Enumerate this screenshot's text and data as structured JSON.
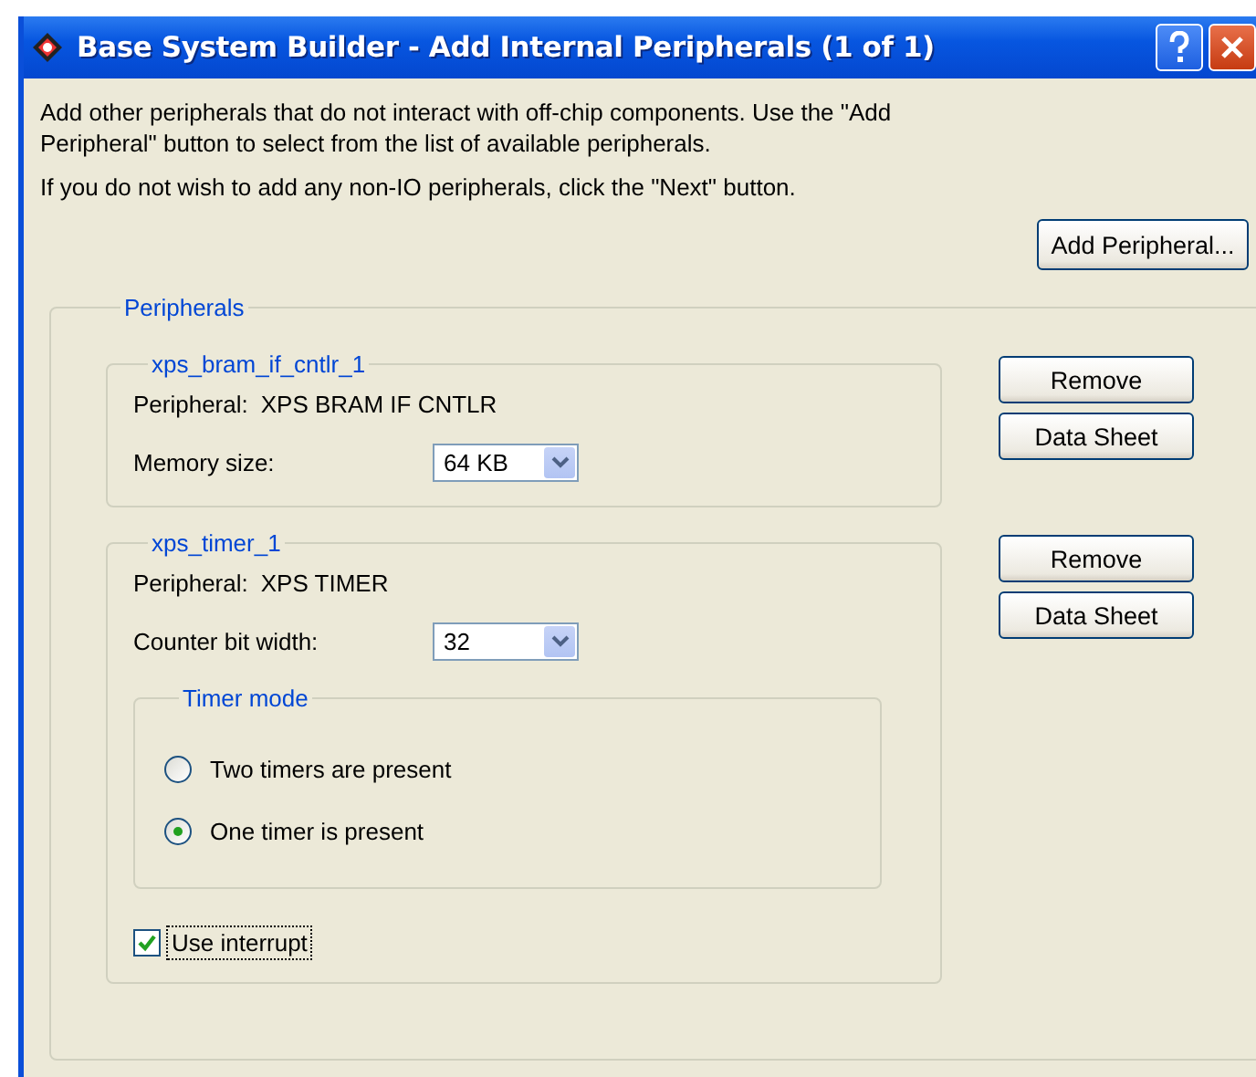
{
  "window": {
    "title": "Base System Builder - Add Internal Peripherals (1 of 1)"
  },
  "intro": [
    "Add other peripherals that do not interact with off-chip components.  Use the \"Add Peripheral\" button to select from the list of available peripherals.",
    "If you do not wish to add any non-IO peripherals, click the \"Next\" button."
  ],
  "add_button": "Add Peripheral...",
  "peripherals_group": {
    "title": "Peripherals",
    "items": [
      {
        "name": "xps_bram_if_cntlr_1",
        "peripheral_label": "Peripheral:",
        "peripheral_value": "XPS BRAM IF CNTLR",
        "buttons": [
          "Remove",
          "Data Sheet"
        ],
        "fields": [
          {
            "kind": "dropdown",
            "label": "Memory size:",
            "value": "64 KB"
          }
        ]
      },
      {
        "name": "xps_timer_1",
        "peripheral_label": "Peripheral:",
        "peripheral_value": "XPS TIMER",
        "buttons": [
          "Remove",
          "Data Sheet"
        ],
        "fields": [
          {
            "kind": "dropdown",
            "label": "Counter bit width:",
            "value": "32"
          },
          {
            "kind": "radio_group",
            "title": "Timer mode",
            "options": [
              {
                "label": "Two timers are present",
                "selected": false
              },
              {
                "label": "One timer is present",
                "selected": true
              }
            ]
          },
          {
            "kind": "checkbox",
            "label": "Use interrupt",
            "checked": true
          }
        ]
      }
    ]
  }
}
